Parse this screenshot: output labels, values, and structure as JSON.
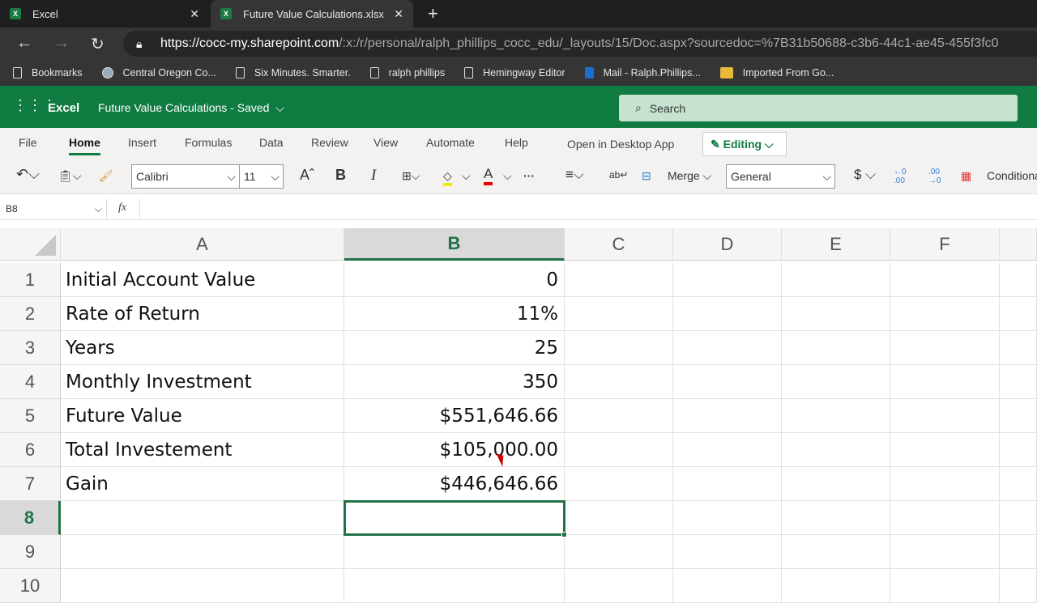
{
  "browser": {
    "tabs": [
      {
        "label": "Excel"
      },
      {
        "label": "Future Value Calculations.xlsx"
      }
    ],
    "url_host": "https://cocc-my.sharepoint.com",
    "url_path": "/:x:/r/personal/ralph_phillips_cocc_edu/_layouts/15/Doc.aspx?sourcedoc=%7B31b50688-c3b6-44c1-ae45-455f3fc0",
    "bookmarks": [
      "Bookmarks",
      "Central Oregon Co...",
      "Six Minutes. Smarter.",
      "ralph phillips",
      "Hemingway Editor",
      "Mail - Ralph.Phillips...",
      "Imported From Go..."
    ]
  },
  "app": {
    "name": "Excel",
    "doc_title": "Future Value Calculations",
    "status": "Saved",
    "search_placeholder": "Search"
  },
  "ribbon": {
    "tabs": [
      "File",
      "Home",
      "Insert",
      "Formulas",
      "Data",
      "Review",
      "View",
      "Automate",
      "Help"
    ],
    "active_tab": "Home",
    "open_desktop": "Open in Desktop App",
    "mode": "Editing",
    "font": "Calibri",
    "size": "11",
    "merge": "Merge",
    "number_format": "General",
    "conditional": "Conditional"
  },
  "formula_bar": {
    "name_box": "B8",
    "fx": "fx",
    "value": ""
  },
  "sheet": {
    "columns": [
      "A",
      "B",
      "C",
      "D",
      "E",
      "F"
    ],
    "active_col": "B",
    "active_row": "8",
    "rows": [
      {
        "n": "1",
        "a": "Initial Account Value",
        "b": "0"
      },
      {
        "n": "2",
        "a": "Rate of Return",
        "b": "11%"
      },
      {
        "n": "3",
        "a": "Years",
        "b": "25"
      },
      {
        "n": "4",
        "a": "Monthly Investment",
        "b": "350"
      },
      {
        "n": "5",
        "a": "Future Value",
        "b": "$551,646.66"
      },
      {
        "n": "6",
        "a": "Total Investement",
        "b": "$105,000.00"
      },
      {
        "n": "7",
        "a": "Gain",
        "b": "$446,646.66"
      },
      {
        "n": "8",
        "a": "",
        "b": ""
      },
      {
        "n": "9",
        "a": "",
        "b": ""
      },
      {
        "n": "10",
        "a": "",
        "b": ""
      }
    ]
  },
  "colors": {
    "excel_green": "#107c41",
    "selection": "#217346"
  }
}
